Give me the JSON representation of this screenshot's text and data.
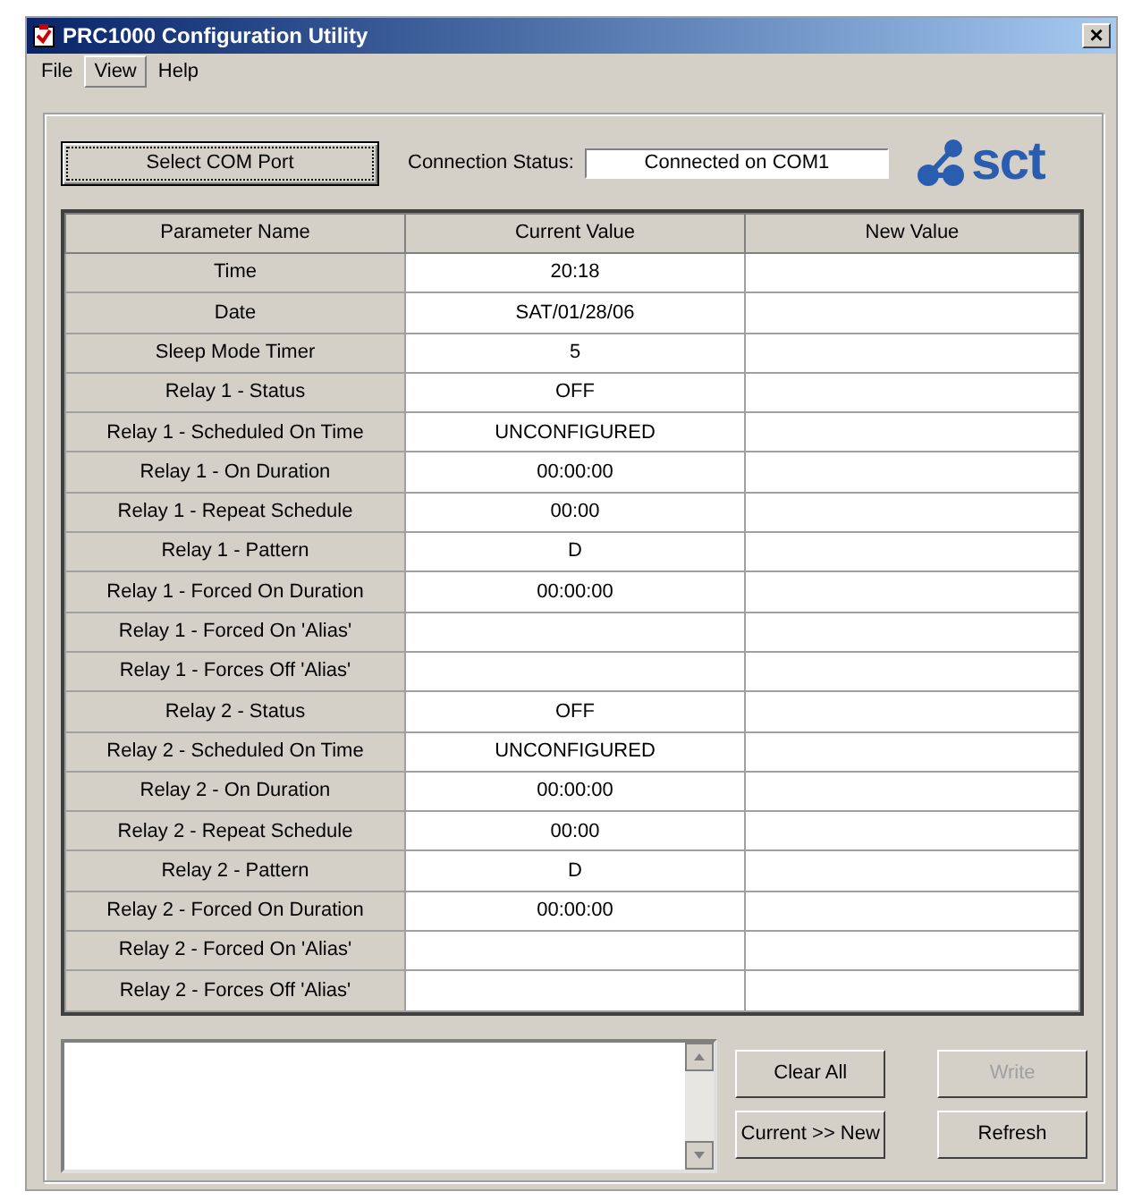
{
  "window": {
    "title": "PRC1000 Configuration Utility",
    "close": "×"
  },
  "menu": [
    {
      "label": "File",
      "selected": false
    },
    {
      "label": "View",
      "selected": true
    },
    {
      "label": "Help",
      "selected": false
    }
  ],
  "select_com_port": "Select COM Port",
  "connection_status": {
    "label": "Connection Status:",
    "value": "Connected on COM1"
  },
  "logo": "sct",
  "table": {
    "columns": [
      "Parameter Name",
      "Current Value",
      "New Value"
    ],
    "rows": [
      [
        "Time",
        "20:18",
        ""
      ],
      [
        "Date",
        "SAT/01/28/06",
        ""
      ],
      [
        "Sleep Mode Timer",
        "5",
        ""
      ],
      [
        "Relay 1 - Status",
        "OFF",
        ""
      ],
      [
        "Relay 1 - Scheduled On Time",
        "UNCONFIGURED",
        ""
      ],
      [
        "Relay 1 - On Duration",
        "00:00:00",
        ""
      ],
      [
        "Relay 1 - Repeat Schedule",
        "00:00",
        ""
      ],
      [
        "Relay 1 - Pattern",
        "D",
        ""
      ],
      [
        "Relay 1 - Forced On Duration",
        "00:00:00",
        ""
      ],
      [
        "Relay 1 - Forced On 'Alias'",
        "",
        ""
      ],
      [
        "Relay 1 - Forces Off 'Alias'",
        "",
        ""
      ],
      [
        "Relay 2 - Status",
        "OFF",
        ""
      ],
      [
        "Relay 2 - Scheduled On Time",
        "UNCONFIGURED",
        ""
      ],
      [
        "Relay 2 - On Duration",
        "00:00:00",
        ""
      ],
      [
        "Relay 2 - Repeat Schedule",
        "00:00",
        ""
      ],
      [
        "Relay 2 - Pattern",
        "D",
        ""
      ],
      [
        "Relay 2 - Forced On Duration",
        "00:00:00",
        ""
      ],
      [
        "Relay 2 - Forced On 'Alias'",
        "",
        ""
      ],
      [
        "Relay 2 - Forces Off 'Alias'",
        "",
        ""
      ]
    ]
  },
  "buttons": [
    {
      "label": "Clear All",
      "disabled": false
    },
    {
      "label": "Write",
      "disabled": true
    },
    {
      "label": "Current >> New",
      "disabled": false
    },
    {
      "label": "Refresh",
      "disabled": false
    }
  ]
}
